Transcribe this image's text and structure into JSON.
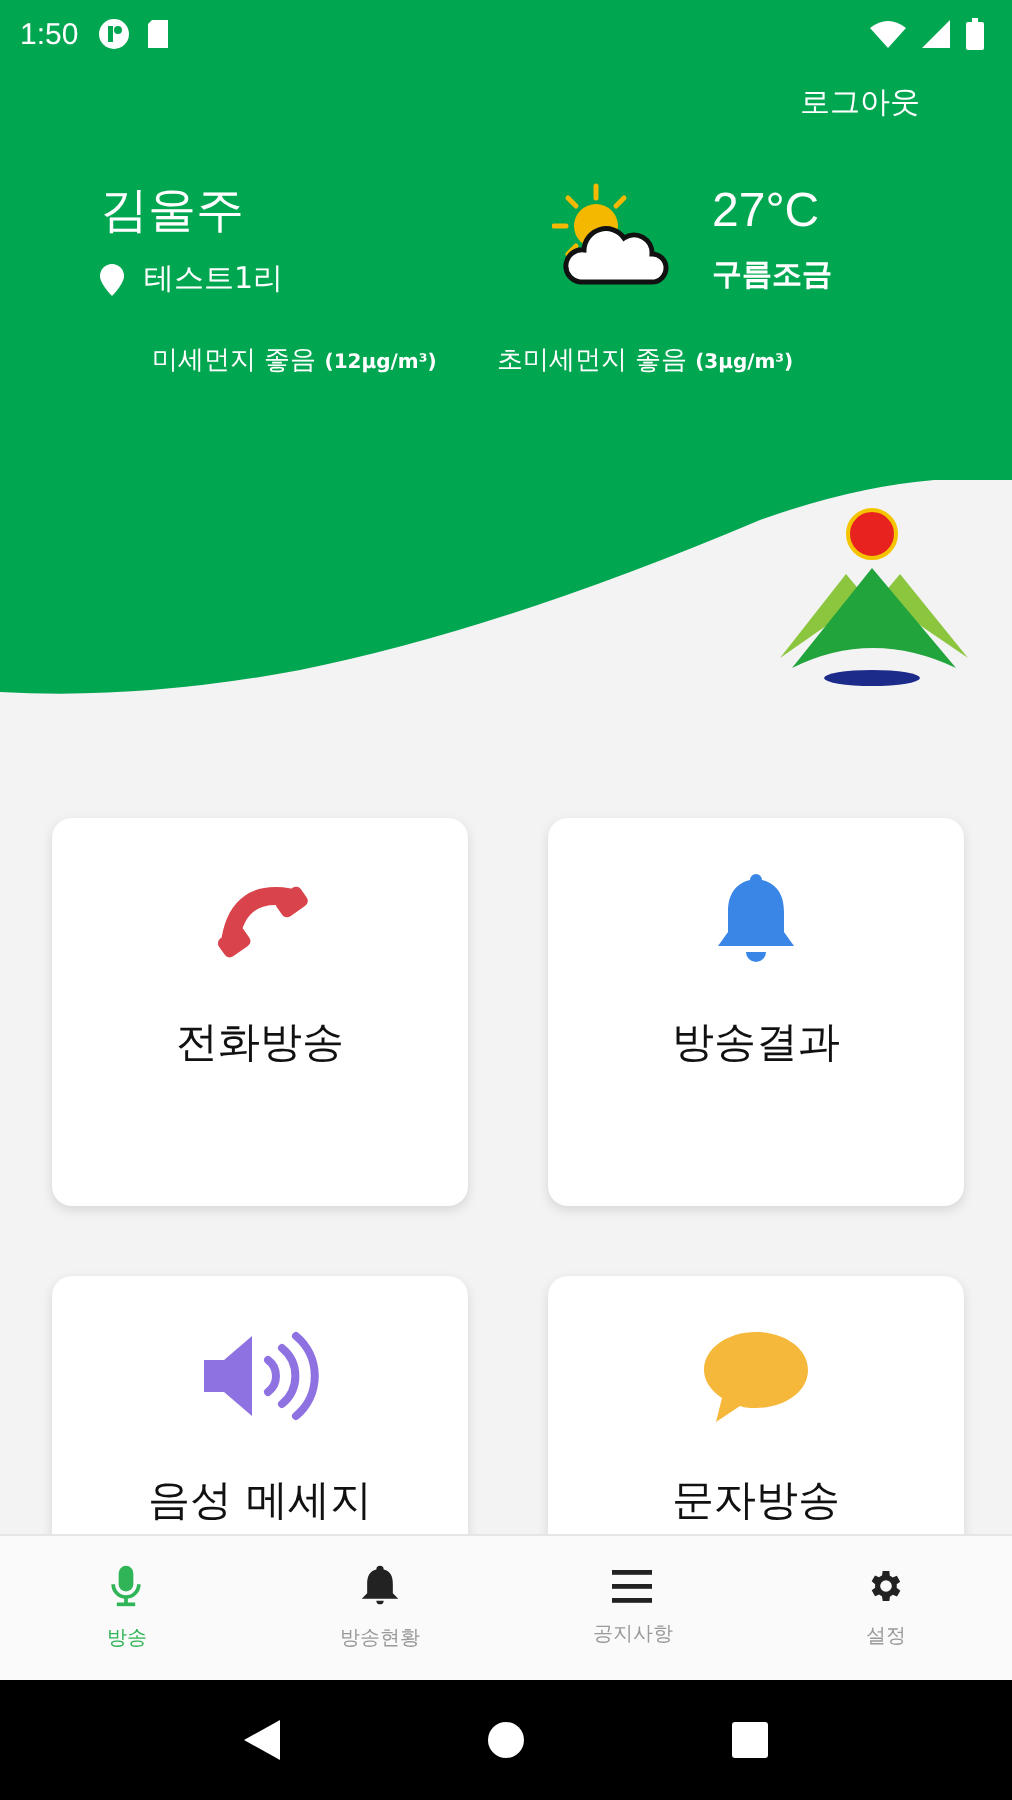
{
  "status_bar": {
    "time": "1:50"
  },
  "header": {
    "logout": "로그아웃",
    "user_name": "김울주",
    "location": "테스트1리",
    "temperature": "27°C",
    "condition": "구름조금",
    "air": [
      {
        "label": "미세먼지 좋음",
        "reading": "(12μg/m³)"
      },
      {
        "label": "초미세먼지 좋음",
        "reading": "(3μg/m³)"
      }
    ]
  },
  "menu_cards": [
    {
      "kind": "phone",
      "label": "전화방송"
    },
    {
      "kind": "bell",
      "label": "방송결과"
    },
    {
      "kind": "speaker",
      "label": "음성 메세지"
    },
    {
      "kind": "chat",
      "label": "문자방송"
    }
  ],
  "bottom_nav": [
    {
      "kind": "mic",
      "label": "방송",
      "selected": true
    },
    {
      "kind": "bell",
      "label": "방송현황",
      "selected": false
    },
    {
      "kind": "menu",
      "label": "공지사항",
      "selected": false
    },
    {
      "kind": "gear",
      "label": "설정",
      "selected": false
    }
  ]
}
